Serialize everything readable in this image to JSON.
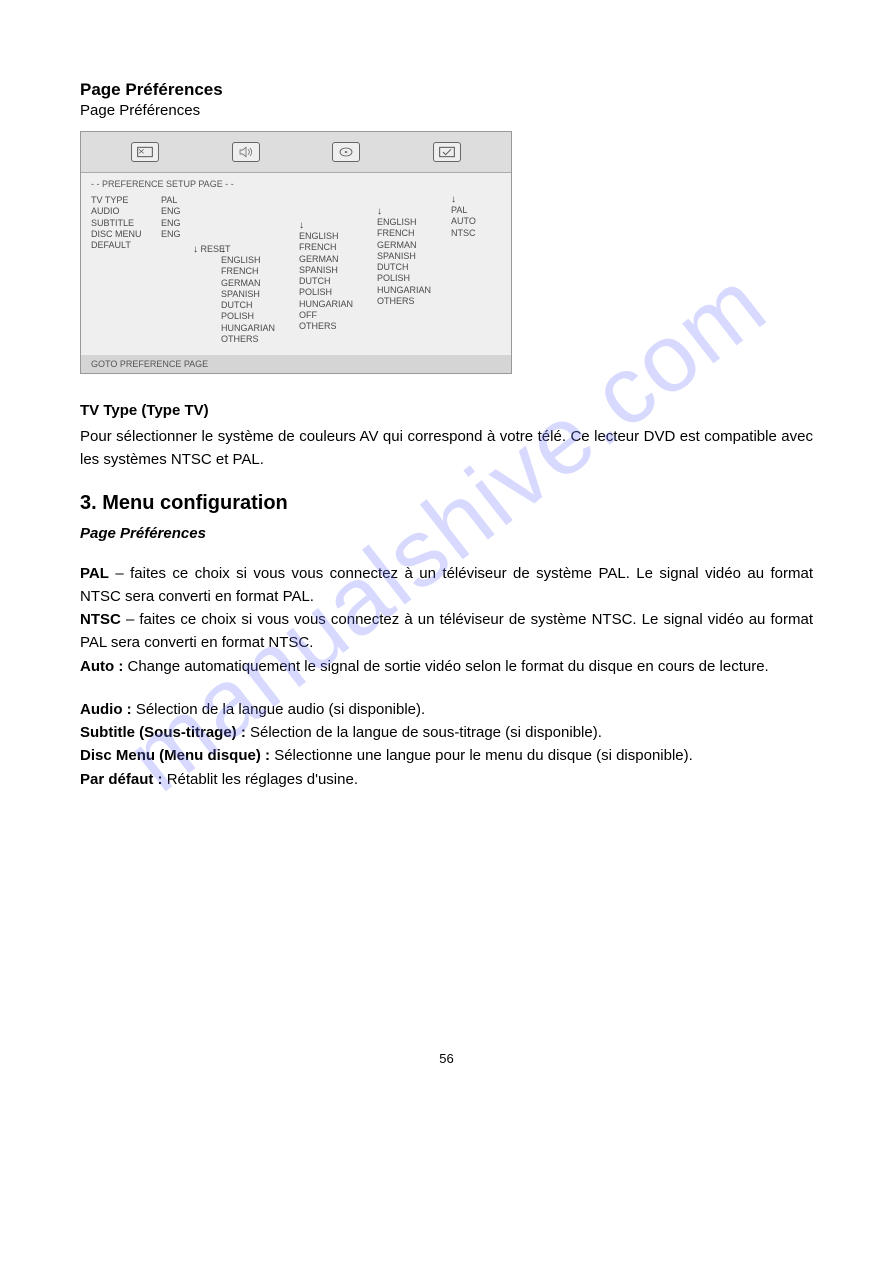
{
  "title": "Page Préférences",
  "subtitle": "Page Préférences",
  "menu": {
    "header": "- - PREFERENCE SETUP PAGE - -",
    "labels": [
      "TV TYPE",
      "AUDIO",
      "SUBTITLE",
      "DISC MENU",
      "DEFAULT"
    ],
    "values": [
      "PAL",
      "ENG",
      "ENG",
      "ENG",
      ""
    ],
    "reset": "RESET",
    "lang_col_a": [
      "ENGLISH",
      "FRENCH",
      "GERMAN",
      "SPANISH",
      "DUTCH",
      "POLISH",
      "HUNGARIAN",
      "OTHERS"
    ],
    "lang_col_b": [
      "ENGLISH",
      "FRENCH",
      "GERMAN",
      "SPANISH",
      "DUTCH",
      "POLISH",
      "HUNGARIAN",
      "OFF",
      "OTHERS"
    ],
    "lang_col_c": [
      "ENGLISH",
      "FRENCH",
      "GERMAN",
      "SPANISH",
      "DUTCH",
      "POLISH",
      "HUNGARIAN",
      "OTHERS"
    ],
    "pal_col": [
      "PAL",
      "AUTO",
      "NTSC"
    ],
    "footer": "GOTO PREFERENCE PAGE"
  },
  "tvtype": {
    "heading": "TV Type (Type TV)",
    "body": "Pour sélectionner le système de couleurs AV qui correspond à votre télé. Ce lecteur DVD est compatible avec les systèmes NTSC et PAL."
  },
  "section3": {
    "heading": "3.  Menu configuration",
    "sub": "Page Préférences",
    "defs_block1": [
      {
        "label": "PAL",
        "sep": " – ",
        "text": "faites ce choix si vous vous connectez à un téléviseur de système PAL. Le signal vidéo au format NTSC sera converti en format PAL."
      },
      {
        "label": "NTSC",
        "sep": " – ",
        "text": "faites ce choix si vous vous connectez à un téléviseur de système NTSC. Le signal vidéo au format PAL sera converti en format NTSC."
      },
      {
        "label": "Auto :",
        "sep": " ",
        "text": "Change automatiquement le signal de sortie vidéo selon le format du disque en cours de lecture."
      }
    ],
    "defs_block2": [
      {
        "label": "Audio :",
        "sep": " ",
        "text": "Sélection de la langue audio (si disponible)."
      },
      {
        "label": "Subtitle (Sous-titrage) :",
        "sep": " ",
        "text": "Sélection de la langue de sous-titrage (si disponible)."
      },
      {
        "label": "Disc Menu (Menu disque) :",
        "sep": " ",
        "text": "Sélectionne une langue pour le menu du disque (si disponible)."
      },
      {
        "label": "Par défaut :",
        "sep": " ",
        "text": "Rétablit les réglages d'usine."
      }
    ]
  },
  "watermark": "manualshive.com",
  "page_number": "56"
}
